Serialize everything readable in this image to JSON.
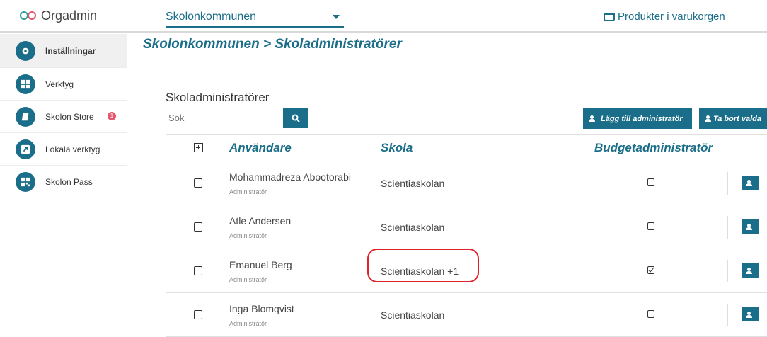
{
  "app": {
    "title": "Orgadmin"
  },
  "header": {
    "org_select_value": "Skolonkommunen",
    "cart_label": "Produkter i varukorgen"
  },
  "sidebar": {
    "items": [
      {
        "label": "Inställningar",
        "icon": "gear-icon",
        "active": true
      },
      {
        "label": "Verktyg",
        "icon": "grid-icon"
      },
      {
        "label": "Skolon Store",
        "icon": "book-icon",
        "badge": "1"
      },
      {
        "label": "Lokala verktyg",
        "icon": "external-link-icon"
      },
      {
        "label": "Skolon Pass",
        "icon": "qr-code-icon"
      }
    ]
  },
  "main": {
    "breadcrumb": "Skolonkommunen > Skoladministratörer",
    "section_title": "Skoladministratörer",
    "search_placeholder": "Sök",
    "add_button": "Lägg till administratör",
    "remove_button": "Ta bort valda"
  },
  "table": {
    "headers": {
      "user": "Användare",
      "school": "Skola",
      "budget": "Budgetadministratör"
    },
    "rows": [
      {
        "name": "Mohammadreza Abootorabi",
        "role": "Administratör",
        "school": "Scientiaskolan",
        "budget": false
      },
      {
        "name": "Atle Andersen",
        "role": "Administratör",
        "school": "Scientiaskolan",
        "budget": false
      },
      {
        "name": "Emanuel Berg",
        "role": "Administratör",
        "school": "Scientiaskolan +1",
        "budget": true
      },
      {
        "name": "Inga Blomqvist",
        "role": "Administratör",
        "school": "Scientiaskolan",
        "budget": false
      }
    ]
  },
  "colors": {
    "brand": "#1b6e89",
    "accent": "#e4576c",
    "annotation": "#e0222a"
  }
}
